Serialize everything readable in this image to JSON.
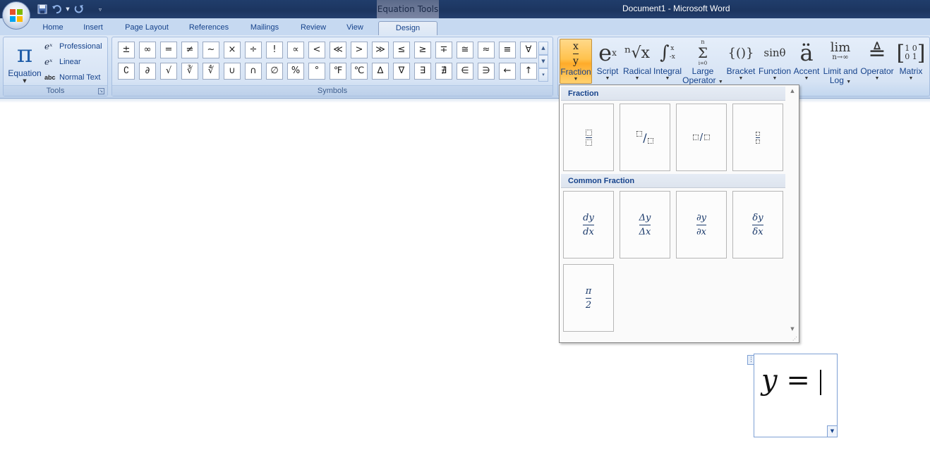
{
  "window": {
    "context_tab_title": "Equation Tools",
    "document_title": "Document1 - Microsoft Word"
  },
  "qat": {
    "save_icon": "save-icon",
    "undo_icon": "undo-icon",
    "redo_icon": "redo-icon",
    "customize_icon": "chevron-down-icon"
  },
  "tabs": [
    "Home",
    "Insert",
    "Page Layout",
    "References",
    "Mailings",
    "Review",
    "View",
    "Design"
  ],
  "active_tab": "Design",
  "tools": {
    "equation_label": "Equation",
    "professional_label": "Professional",
    "linear_label": "Linear",
    "normal_text_label": "Normal Text",
    "group_label": "Tools"
  },
  "symbols": {
    "group_label": "Symbols",
    "row1": [
      "±",
      "∞",
      "=",
      "≠",
      "~",
      "×",
      "÷",
      "!",
      "∝",
      "<",
      "≪",
      ">",
      "≫",
      "≤",
      "≥",
      "∓",
      "≅",
      "≈",
      "≡",
      "∀"
    ],
    "row2": [
      "∁",
      "∂",
      "√",
      "∛",
      "∜",
      "∪",
      "∩",
      "∅",
      "%",
      "°",
      "℉",
      "℃",
      "∆",
      "∇",
      "∃",
      "∄",
      "∈",
      "∋",
      "←",
      "↑"
    ]
  },
  "structures": {
    "fraction": {
      "label": "Fraction",
      "icon_top": "x",
      "icon_bottom": "y"
    },
    "script": {
      "label": "Script",
      "icon": "e",
      "icon_sup": "x"
    },
    "radical": {
      "label": "Radical",
      "icon": "ⁿ√x"
    },
    "integral": {
      "label": "Integral",
      "icon": "∫",
      "icon_upper": "x",
      "icon_lower": "-x"
    },
    "large_operator": {
      "label_line1": "Large",
      "label_line2": "Operator",
      "icon": "Σ",
      "icon_upper": "n",
      "icon_lower": "i=0"
    },
    "bracket": {
      "label": "Bracket",
      "icon": "{()}"
    },
    "function": {
      "label": "Function",
      "icon": "sinθ"
    },
    "accent": {
      "label": "Accent",
      "icon": "ä"
    },
    "limit_log": {
      "label_line1": "Limit and",
      "label_line2": "Log",
      "icon": "lim",
      "icon_sub": "n→∞"
    },
    "operator": {
      "label": "Operator",
      "icon": "≜"
    },
    "matrix": {
      "label": "Matrix",
      "icon_r1": "1 0",
      "icon_r2": "0 1"
    }
  },
  "fraction_panel": {
    "section1": "Fraction",
    "section2": "Common Fraction",
    "common": [
      {
        "num": "dy",
        "den": "dx"
      },
      {
        "num": "Δy",
        "den": "Δx"
      },
      {
        "num": "∂y",
        "den": "∂x"
      },
      {
        "num": "δy",
        "den": "δx"
      },
      {
        "num": "π",
        "den": "2"
      }
    ]
  },
  "equation": {
    "var": "y",
    "op": " ="
  }
}
